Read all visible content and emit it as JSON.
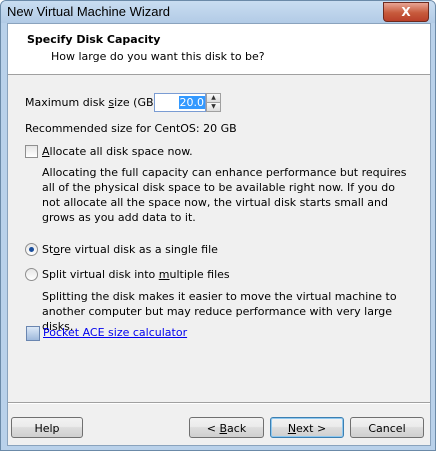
{
  "window": {
    "title": "New Virtual Machine Wizard",
    "close_label": "X"
  },
  "header": {
    "title": "Specify Disk Capacity",
    "subtitle": "How large do you want this disk to be?"
  },
  "disk_size": {
    "label_pre": "Maximum disk ",
    "label_mnemonic": "s",
    "label_post": "ize (GB):",
    "value": "20.0"
  },
  "recommended": "Recommended size for CentOS: 20 GB",
  "allocate": {
    "label_mnemonic": "A",
    "label_rest": "llocate all disk space now.",
    "checked": false,
    "description": "Allocating the full capacity can enhance performance but requires all of the physical disk space to be available right now. If you do not allocate all the space now, the virtual disk starts small and grows as you add data to it."
  },
  "store_options": {
    "single": {
      "label_pre": "St",
      "label_mnemonic": "o",
      "label_post": "re virtual disk as a single file",
      "selected": true
    },
    "multiple": {
      "label_pre": "Split virtual disk into ",
      "label_mnemonic": "m",
      "label_post": "ultiple files",
      "selected": false
    },
    "description": "Splitting the disk makes it easier to move the virtual machine to another computer but may reduce performance with very large disks."
  },
  "link": {
    "text": "Pocket ACE size calculator"
  },
  "buttons": {
    "help": "Help",
    "back_pre": "< ",
    "back_mnemonic": "B",
    "back_post": "ack",
    "next_mnemonic": "N",
    "next_post": "ext >",
    "cancel": "Cancel"
  }
}
